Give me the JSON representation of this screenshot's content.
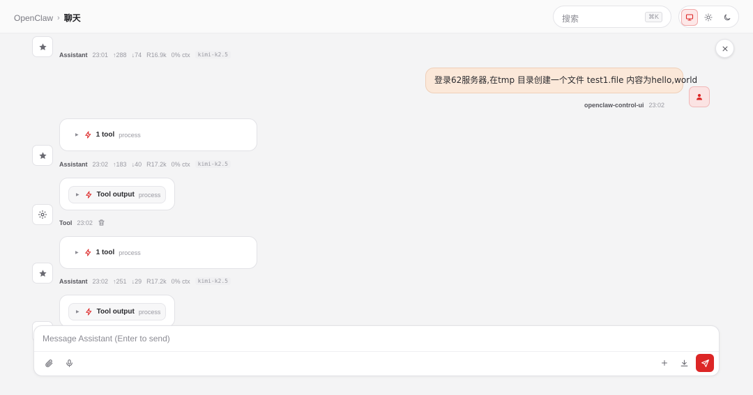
{
  "breadcrumb": {
    "root": "OpenClaw",
    "separator": "›",
    "current": "聊天"
  },
  "search": {
    "placeholder": "搜索",
    "shortcut": "⌘K"
  },
  "theme": {
    "options": [
      "system",
      "light",
      "dark"
    ],
    "active": "system"
  },
  "colors": {
    "accent": "#dc2626",
    "user_bubble": "#fbe8d9"
  },
  "messages": [
    {
      "role": "assistant",
      "meta": {
        "who": "Assistant",
        "time": "23:01",
        "up": "↑288",
        "down": "↓74",
        "r": "R16.9k",
        "ctx": "0% ctx",
        "model": "kimi-k2.5"
      }
    },
    {
      "role": "user",
      "text": "登录62服务器,在tmp 目录创建一个文件 test1.file 内容为hello,world",
      "meta": {
        "who": "openclaw-control-ui",
        "time": "23:02"
      }
    },
    {
      "role": "assistant",
      "tool": {
        "name": "1 tool",
        "tag": "process"
      },
      "meta": {
        "who": "Assistant",
        "time": "23:02",
        "up": "↑183",
        "down": "↓40",
        "r": "R17.2k",
        "ctx": "0% ctx",
        "model": "kimi-k2.5"
      }
    },
    {
      "role": "tool",
      "tool": {
        "name": "Tool output",
        "tag": "process"
      },
      "meta": {
        "who": "Tool",
        "time": "23:02"
      }
    },
    {
      "role": "assistant",
      "tool": {
        "name": "1 tool",
        "tag": "process"
      },
      "meta": {
        "who": "Assistant",
        "time": "23:02",
        "up": "↑251",
        "down": "↓29",
        "r": "R17.2k",
        "ctx": "0% ctx",
        "model": "kimi-k2.5"
      }
    },
    {
      "role": "tool",
      "tool": {
        "name": "Tool output",
        "tag": "process"
      }
    }
  ],
  "composer": {
    "placeholder": "Message Assistant (Enter to send)"
  }
}
